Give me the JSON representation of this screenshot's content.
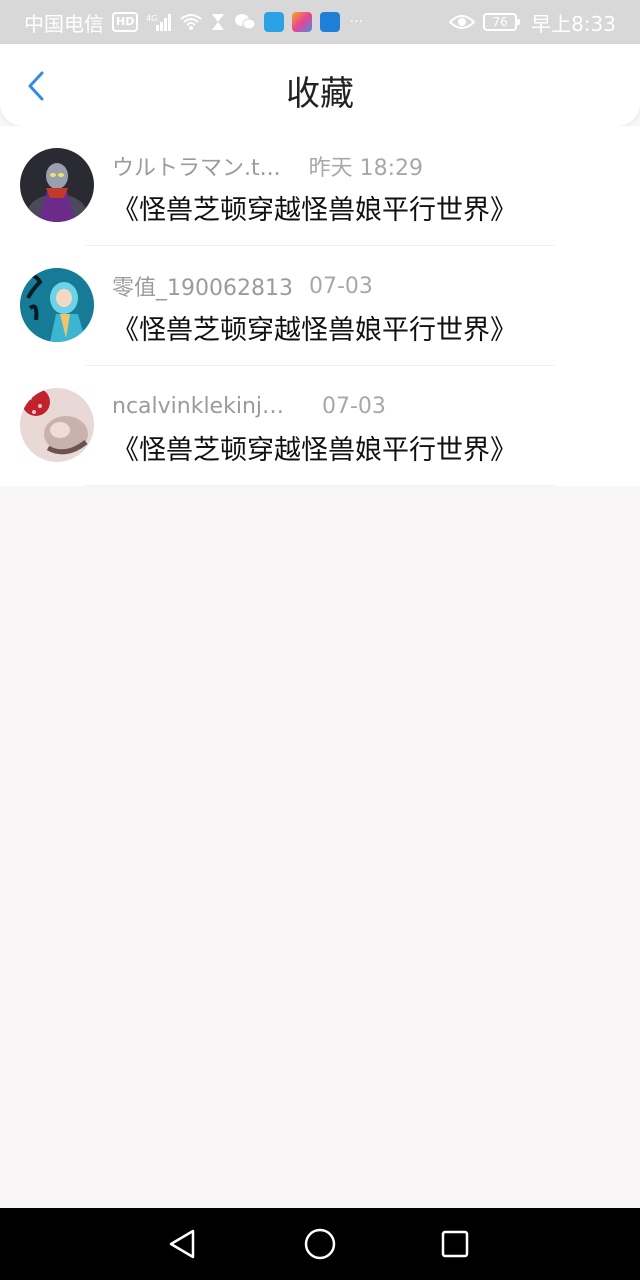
{
  "status_bar": {
    "carrier": "中国电信",
    "hd_badge": "HD",
    "network": "4G",
    "battery": "76",
    "time": "早上8:33",
    "icons": [
      "signal-icon",
      "wifi-icon",
      "hourglass-icon",
      "wechat-icon",
      "app-icon-blue",
      "app-icon-multicolor",
      "app-icon-cloud",
      "more-icon",
      "eye-icon",
      "battery-icon"
    ],
    "more": "···"
  },
  "header": {
    "title": "收藏",
    "back_icon": "chevron-left-icon",
    "accent": "#2f8de4"
  },
  "bookmarks": [
    {
      "username": "ウルトラマン.t...",
      "time": "昨天 18:29",
      "title": "《怪兽芝顿穿越怪兽娘平行世界》"
    },
    {
      "username": "零值_190062813",
      "time": "07-03",
      "title": "《怪兽芝顿穿越怪兽娘平行世界》"
    },
    {
      "username": "ncalvinklekinje...",
      "time": "07-03",
      "title": "《怪兽芝顿穿越怪兽娘平行世界》"
    }
  ],
  "system_nav": {
    "buttons": [
      "back-triangle-icon",
      "home-circle-icon",
      "recents-square-icon"
    ]
  }
}
